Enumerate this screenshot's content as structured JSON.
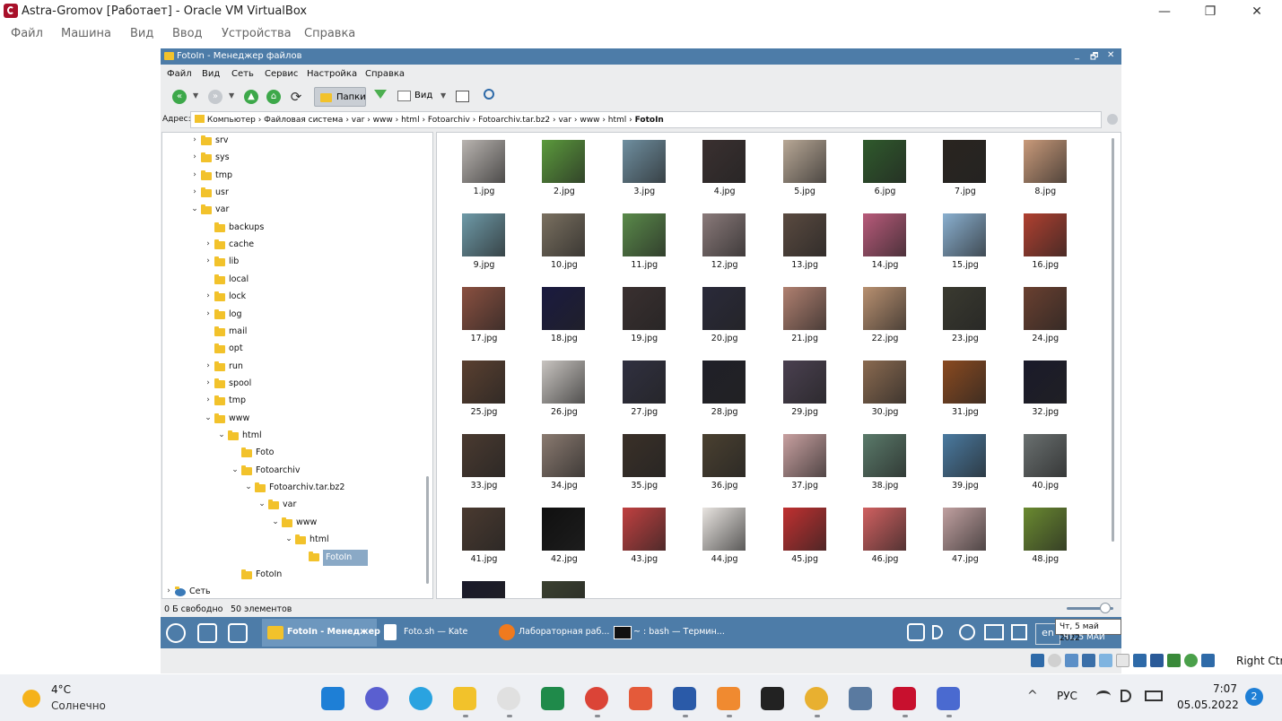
{
  "host_window": {
    "title": "Astra-Gromov [Работает] - Oracle VM VirtualBox",
    "menu": [
      "Файл",
      "Машина",
      "Вид",
      "Ввод",
      "Устройства",
      "Справка"
    ],
    "controls": [
      "—",
      "❐",
      "✕"
    ]
  },
  "file_manager": {
    "title": "FotoIn - Менеджер файлов",
    "title_controls": [
      "_",
      "🗗",
      "✕"
    ],
    "menu": [
      "Файл",
      "Вид",
      "Сеть",
      "Сервис",
      "Настройка",
      "Справка"
    ],
    "toolbar": {
      "back": "«",
      "forward": "»",
      "up": "▲",
      "home": "⌂",
      "refresh": "⟳",
      "folders_label": "Папки",
      "view_label": "Вид"
    },
    "address": {
      "label": "Адрес:",
      "crumbs": [
        "Компьютер",
        "Файловая система",
        "var",
        "www",
        "html",
        "Fotoarchiv",
        "Fotoarchiv.tar.bz2",
        "var",
        "www",
        "html"
      ],
      "current": "FotoIn"
    },
    "tree": [
      {
        "name": "srv",
        "depth": 0,
        "arrow": ">"
      },
      {
        "name": "sys",
        "depth": 0,
        "arrow": ">"
      },
      {
        "name": "tmp",
        "depth": 0,
        "arrow": ">"
      },
      {
        "name": "usr",
        "depth": 0,
        "arrow": ">"
      },
      {
        "name": "var",
        "depth": 0,
        "arrow": "v"
      },
      {
        "name": "backups",
        "depth": 1,
        "arrow": ""
      },
      {
        "name": "cache",
        "depth": 1,
        "arrow": ">"
      },
      {
        "name": "lib",
        "depth": 1,
        "arrow": ">"
      },
      {
        "name": "local",
        "depth": 1,
        "arrow": ""
      },
      {
        "name": "lock",
        "depth": 1,
        "arrow": ">"
      },
      {
        "name": "log",
        "depth": 1,
        "arrow": ">"
      },
      {
        "name": "mail",
        "depth": 1,
        "arrow": ""
      },
      {
        "name": "opt",
        "depth": 1,
        "arrow": ""
      },
      {
        "name": "run",
        "depth": 1,
        "arrow": ">"
      },
      {
        "name": "spool",
        "depth": 1,
        "arrow": ">"
      },
      {
        "name": "tmp",
        "depth": 1,
        "arrow": ">"
      },
      {
        "name": "www",
        "depth": 1,
        "arrow": "v"
      },
      {
        "name": "html",
        "depth": 2,
        "arrow": "v"
      },
      {
        "name": "Foto",
        "depth": 3,
        "arrow": ""
      },
      {
        "name": "Fotoarchiv",
        "depth": 3,
        "arrow": "v"
      },
      {
        "name": "Fotoarchiv.tar.bz2",
        "depth": 4,
        "arrow": "v"
      },
      {
        "name": "var",
        "depth": 5,
        "arrow": "v"
      },
      {
        "name": "www",
        "depth": 6,
        "arrow": "v"
      },
      {
        "name": "html",
        "depth": 7,
        "arrow": "v"
      },
      {
        "name": "FotoIn",
        "depth": 8,
        "arrow": "",
        "selected": true
      },
      {
        "name": "FotoIn",
        "depth": 3,
        "arrow": ""
      },
      {
        "name": "Сеть",
        "depth": -1,
        "arrow": ">"
      }
    ],
    "files": [
      "1.jpg",
      "2.jpg",
      "3.jpg",
      "4.jpg",
      "5.jpg",
      "6.jpg",
      "7.jpg",
      "8.jpg",
      "9.jpg",
      "10.jpg",
      "11.jpg",
      "12.jpg",
      "13.jpg",
      "14.jpg",
      "15.jpg",
      "16.jpg",
      "17.jpg",
      "18.jpg",
      "19.jpg",
      "20.jpg",
      "21.jpg",
      "22.jpg",
      "23.jpg",
      "24.jpg",
      "25.jpg",
      "26.jpg",
      "27.jpg",
      "28.jpg",
      "29.jpg",
      "30.jpg",
      "31.jpg",
      "32.jpg",
      "33.jpg",
      "34.jpg",
      "35.jpg",
      "36.jpg",
      "37.jpg",
      "38.jpg",
      "39.jpg",
      "40.jpg",
      "41.jpg",
      "42.jpg",
      "43.jpg",
      "44.jpg",
      "45.jpg",
      "46.jpg",
      "47.jpg",
      "48.jpg",
      "",
      ""
    ],
    "thumb_colors": [
      "#b9b4b0",
      "#5b9a3c",
      "#6f8fa0",
      "#3a3030",
      "#b8a896",
      "#2f5a2c",
      "#2a2520",
      "#c99a7a",
      "#6e9aa8",
      "#7a7060",
      "#5a8a4a",
      "#8a7a7a",
      "#5a4a40",
      "#b85a7a",
      "#8ab0d0",
      "#b04030",
      "#8a5040",
      "#1a1a40",
      "#3a3030",
      "#2a2a3a",
      "#b08070",
      "#b89070",
      "#3a3a30",
      "#6a4030",
      "#5a4030",
      "#c8c4c0",
      "#303040",
      "#202028",
      "#4a4050",
      "#8a6a50",
      "#8a4a20",
      "#1a1a2a",
      "#4a3a30",
      "#8a7a70",
      "#3a3028",
      "#4a4030",
      "#c8a0a0",
      "#5a7a6a",
      "#4a7aa0",
      "#6a7070",
      "#4a3a30",
      "#101010",
      "#c04040",
      "#e8e4e0",
      "#c03030",
      "#d06060",
      "#c0a0a0",
      "#6a8a30",
      "#1a1a2a",
      "#3a4030"
    ],
    "status": {
      "free": "0 Б свободно",
      "count": "50 элементов"
    },
    "taskbar": {
      "tasks": [
        {
          "label": "FotoIn - Менеджер ...",
          "active": true
        },
        {
          "label": "Foto.sh  — Kate",
          "active": false
        },
        {
          "label": "Лабораторная раб...",
          "active": false
        },
        {
          "label": "~ : bash — Термин...",
          "active": false
        }
      ],
      "lang": "en",
      "clock": "ЧТ, 5 МАЙ",
      "tooltip": "Чт,  5 май 2022"
    }
  },
  "vbox_status": {
    "hostkey": "Right Ctrl"
  },
  "windows_taskbar": {
    "weather_temp": "4°C",
    "weather_desc": "Солнечно",
    "lang": "РУС",
    "time": "7:07",
    "date": "05.05.2022",
    "notifications": "2",
    "tray_caret": "^"
  }
}
